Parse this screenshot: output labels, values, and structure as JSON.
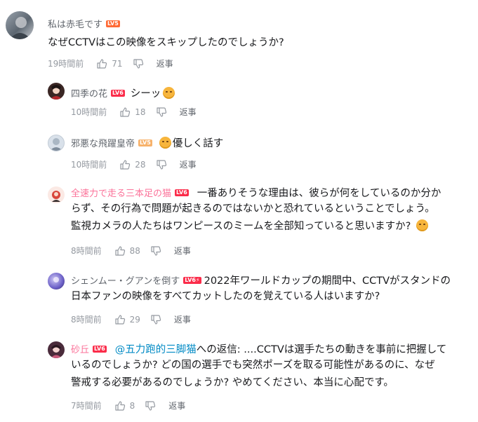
{
  "comments": [
    {
      "username": "私は赤毛です",
      "level": "LV5",
      "text": "なぜCCTVはこの映像をスキップしたのでしょうか?",
      "time": "19時間前",
      "likes": "71",
      "reply_label": "返事"
    },
    {
      "username": "四季の花",
      "level": "LV6",
      "text": "シーッ",
      "time": "10時間前",
      "likes": "18",
      "reply_label": "返事"
    },
    {
      "username": "邪悪な飛躍皇帝",
      "level": "LV5",
      "text": "優しく話す",
      "time": "10時間前",
      "likes": "28",
      "reply_label": "返事"
    },
    {
      "username": "全速力で走る三本足の猫",
      "level": "LV6",
      "text_line1": "一番ありそうな理由は、彼らが何をしているのか分か",
      "text_line2": "らず、その行為で問題が起きるのではないかと恐れているということでしょう。",
      "text_line3": "監視カメラの人たちはワンピースのミームを全部知っていると思いますか?",
      "time": "8時間前",
      "likes": "88",
      "reply_label": "返事"
    },
    {
      "username": "シェンムー・グアンを倒す",
      "level": "LV6⚡",
      "text_line1": "2022年ワールドカップの期間中、CCTVがスタンドの",
      "text_line2": "日本ファンの映像をすべてカットしたのを覚えている人はいますか?",
      "time": "8時間前",
      "likes": "29",
      "reply_label": "返事"
    },
    {
      "username": "砂丘",
      "level": "LV6",
      "mention": "@五力跑的三脚猫",
      "reply_prefix": "への返信:",
      "text_line1": "....CCTVは選手たちの動きを事前に把握して",
      "text_line2": "いるのでしょうか? どの国の選手でも突然ポーズを取る可能性があるのに、なぜ",
      "text_line3": "警戒する必要があるのでしょうか? やめてください、本当に心配です。",
      "time": "7時間前",
      "likes": "8",
      "reply_label": "返事"
    }
  ],
  "colors": {
    "username": "#61666d",
    "username_highlight": "#fb7299",
    "level_orange": "#ff6a35",
    "level_red": "#fb2c4a",
    "level_light": "#f7b26b",
    "meta": "#9499a0",
    "mention": "#008ac5"
  }
}
